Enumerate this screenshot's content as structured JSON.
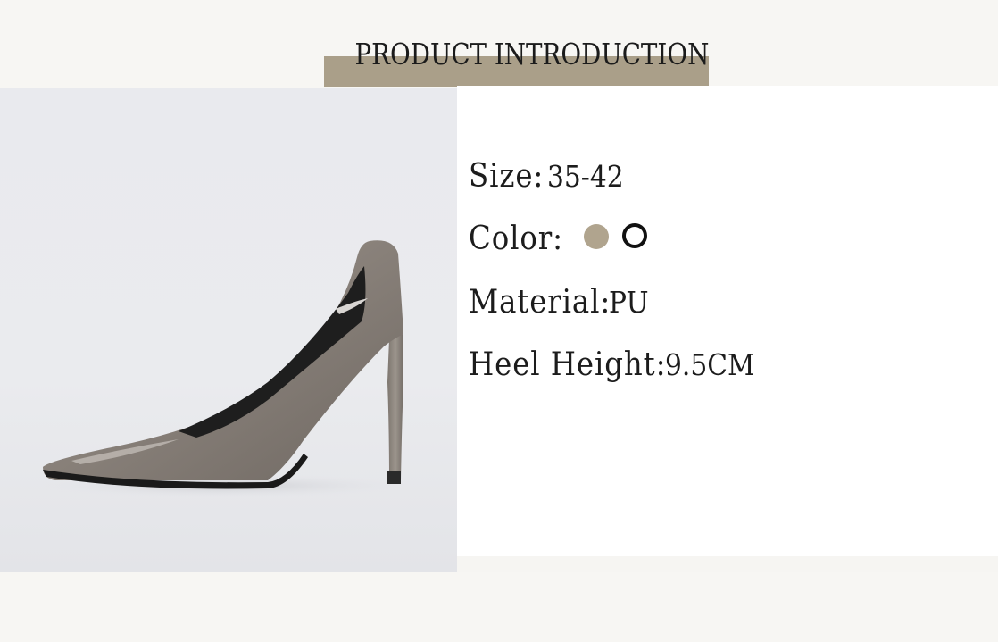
{
  "header": {
    "title": "PRODUCT INTRODUCTION"
  },
  "product": {
    "size_label": "Size:",
    "size_value": "35-42",
    "color_label": "Color:",
    "colors": [
      "#b0a48e",
      "#111111"
    ],
    "material_label": "Material:",
    "material_value": "PU",
    "heel_label": "Heel Height:",
    "heel_value": "9.5CM"
  },
  "theme": {
    "accent": "#aa9f89",
    "shoe": "#8a827b"
  }
}
